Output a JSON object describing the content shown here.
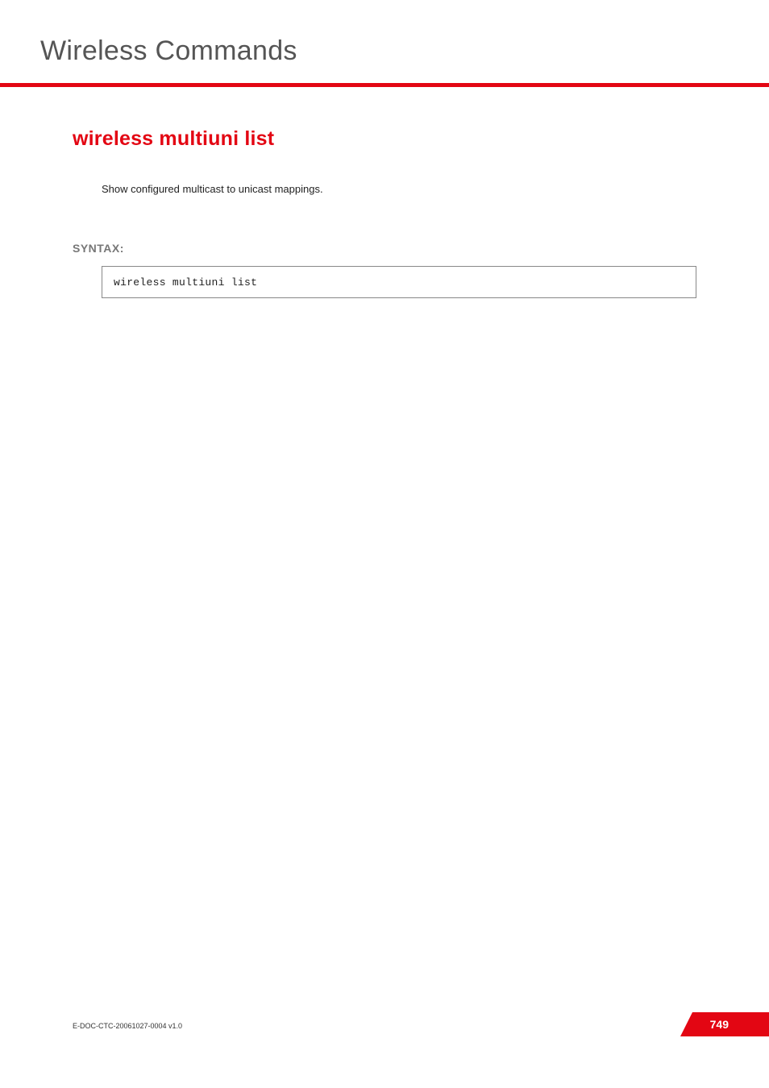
{
  "header": {
    "title": "Wireless Commands"
  },
  "main": {
    "heading": "wireless multiuni list",
    "description": "Show configured multicast to unicast mappings.",
    "syntax_label": "SYNTAX:",
    "syntax_code": "wireless multiuni list"
  },
  "footer": {
    "doc_id": "E-DOC-CTC-20061027-0004 v1.0",
    "page_number": "749"
  }
}
